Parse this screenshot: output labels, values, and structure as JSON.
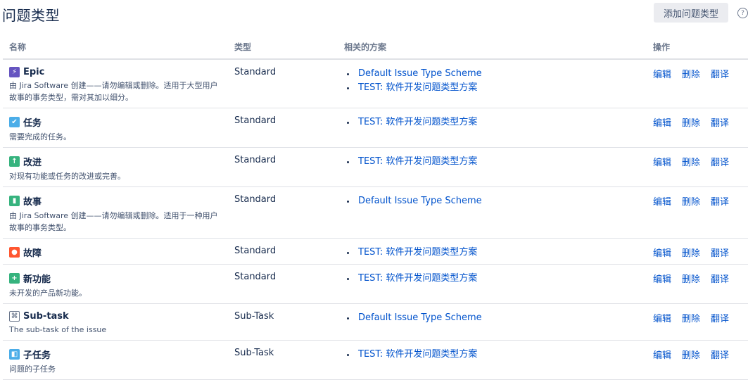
{
  "page": {
    "title": "问题类型",
    "add_button": "添加问题类型",
    "help_icon": "help-icon"
  },
  "table": {
    "headers": {
      "name": "名称",
      "type": "类型",
      "schemes": "相关的方案",
      "ops": "操作"
    },
    "ops_labels": {
      "edit": "编辑",
      "delete": "删除",
      "translate": "翻译"
    },
    "rows": [
      {
        "name": "Epic",
        "icon": "epic-icon",
        "color": "#6554c0",
        "glyph": "⚡",
        "desc": "由 Jira Software 创建——请勿编辑或删除。适用于大型用户故事的事务类型，需对其加以细分。",
        "type": "Standard",
        "schemes": [
          "Default Issue Type Scheme",
          "TEST: 软件开发问题类型方案"
        ]
      },
      {
        "name": "任务",
        "icon": "task-icon",
        "color": "#4bade8",
        "glyph": "✔",
        "desc": "需要完成的任务。",
        "type": "Standard",
        "schemes": [
          "TEST: 软件开发问题类型方案"
        ]
      },
      {
        "name": "改进",
        "icon": "improvement-icon",
        "color": "#36b37e",
        "glyph": "↑",
        "desc": "对现有功能或任务的改进或完善。",
        "type": "Standard",
        "schemes": [
          "TEST: 软件开发问题类型方案"
        ]
      },
      {
        "name": "故事",
        "icon": "story-icon",
        "color": "#36b37e",
        "glyph": "▮",
        "desc": "由 Jira Software 创建——请勿编辑或删除。适用于一种用户故事的事务类型。",
        "type": "Standard",
        "schemes": [
          "Default Issue Type Scheme"
        ]
      },
      {
        "name": "故障",
        "icon": "bug-icon",
        "color": "#ff5630",
        "glyph": "●",
        "desc": "",
        "type": "Standard",
        "schemes": [
          "TEST: 软件开发问题类型方案"
        ]
      },
      {
        "name": "新功能",
        "icon": "new-feature-icon",
        "color": "#36b37e",
        "glyph": "+",
        "desc": "未开发的产品新功能。",
        "type": "Standard",
        "schemes": [
          "TEST: 软件开发问题类型方案"
        ]
      },
      {
        "name": "Sub-task",
        "icon": "subtask-icon",
        "color": "#6b778c",
        "glyph": "⌘",
        "desc": "The sub-task of the issue",
        "type": "Sub-Task",
        "schemes": [
          "Default Issue Type Scheme"
        ]
      },
      {
        "name": "子任务",
        "icon": "child-task-icon",
        "color": "#4bade8",
        "glyph": "◧",
        "desc": "问题的子任务",
        "type": "Sub-Task",
        "schemes": [
          "TEST: 软件开发问题类型方案"
        ]
      }
    ]
  }
}
